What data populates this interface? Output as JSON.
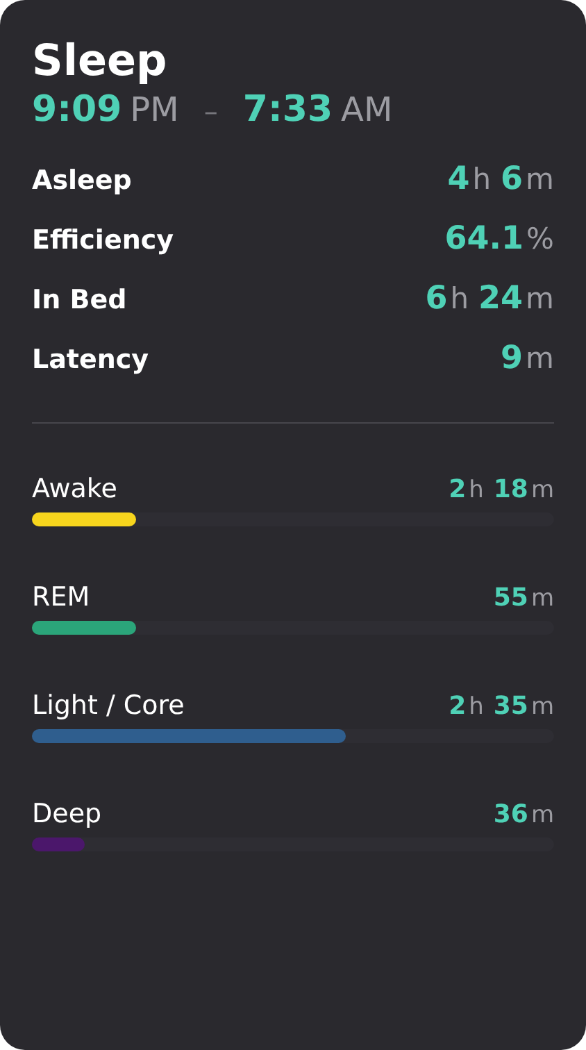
{
  "title": "Sleep",
  "time_range": {
    "start": {
      "value": "9:09",
      "unit": "PM"
    },
    "separator": "–",
    "end": {
      "value": "7:33",
      "unit": "AM"
    }
  },
  "summary": [
    {
      "label": "Asleep",
      "parts": [
        {
          "value": "4",
          "unit": "h"
        },
        {
          "value": "6",
          "unit": "m"
        }
      ]
    },
    {
      "label": "Efficiency",
      "parts": [
        {
          "value": "64.1",
          "unit": "%"
        }
      ]
    },
    {
      "label": "In Bed",
      "parts": [
        {
          "value": "6",
          "unit": "h"
        },
        {
          "value": "24",
          "unit": "m"
        }
      ]
    },
    {
      "label": "Latency",
      "parts": [
        {
          "value": "9",
          "unit": "m"
        }
      ]
    }
  ],
  "stages": [
    {
      "label": "Awake",
      "parts": [
        {
          "value": "2",
          "unit": "h"
        },
        {
          "value": "18",
          "unit": "m"
        }
      ],
      "level": 0.2,
      "color": "#f7d51d"
    },
    {
      "label": "REM",
      "parts": [
        {
          "value": "55",
          "unit": "m"
        }
      ],
      "level": 0.2,
      "color": "#2ba57a"
    },
    {
      "label": "Light / Core",
      "parts": [
        {
          "value": "2",
          "unit": "h"
        },
        {
          "value": "35",
          "unit": "m"
        }
      ],
      "level": 0.6,
      "color": "#2f5e8e"
    },
    {
      "label": "Deep",
      "parts": [
        {
          "value": "36",
          "unit": "m"
        }
      ],
      "level": 0.1,
      "color": "#4b176b"
    }
  ]
}
